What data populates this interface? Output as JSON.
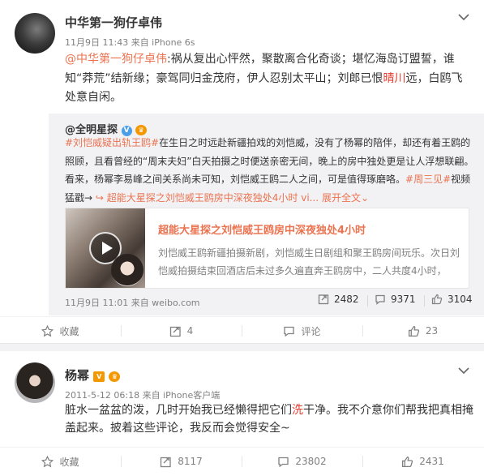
{
  "post1": {
    "author": "中华第一狗仔卓伟",
    "meta": "11月9日 11:43 来自 iPhone 6s",
    "mention": "@中华第一狗仔卓伟",
    "text_part1": ":祸从复出心怦然，聚散离合化奇谈；堪忆海岛订盟誓，谁知“莽荒”结新缘；豪驾同归金茂府，伊人忍别太平山；刘郎已恨",
    "highlight": "晴川",
    "text_part2": "远，白鸥飞处意自闲。",
    "repost": {
      "author": "@全明星探",
      "hashtag1": "#刘恺威疑出轨王鸥#",
      "text1": "在生日之时远赴新疆拍戏的刘恺威，没有了杨幂的陪伴，却还有着王鸥的照顾，且看曾经的“周末夫妇”白天拍摄之时便送亲密无间，晚上的房中独处更是让人浮想联翩。看来，杨幂李易峰之间关系尚未可知，刘恺威王鸥二人之间，可是值得琢磨咯。",
      "hashtag2": "#周三见#",
      "text2": "视频猛戳→",
      "video_link": "超能大星探之刘恺威王鸥房中深夜独处4小时 vi...",
      "expand": "展开全文",
      "media": {
        "title": "超能大星探之刘恺威王鸥房中深夜独处4小时",
        "desc": "刘恺威王鸥新疆拍摄新剧，刘恺威生日剧组和聚王鸥房间玩乐。次日刘恺威拍摄结束回酒店后未过多久遍直奔王鸥房中，二人共度4小时，"
      },
      "meta": "11月9日 11:01 来自 weibo.com",
      "stats": {
        "repost": "2482",
        "comment": "9371",
        "like": "3104"
      }
    },
    "actions": {
      "collect": "收藏",
      "repost": "4",
      "comment": "评论",
      "like": "23"
    }
  },
  "post2": {
    "author": "杨幂",
    "meta": "2011-5-12 06:18 来自 iPhone客户端",
    "text_part1": "脏水一盆盆的泼，几时开始我已经懒得把它们",
    "highlight": "洗",
    "text_part2": "干净。我不介意你们帮我把真相掩盖起来。披着这些评论，我反而会觉得安全~",
    "actions": {
      "collect": "收藏",
      "repost": "8117",
      "comment": "23802",
      "like": "2431"
    }
  },
  "colors": {
    "link": "#eb7350",
    "highlight": "#e63b2e",
    "meta": "#808080",
    "repost_bg": "#f2f2f5"
  }
}
